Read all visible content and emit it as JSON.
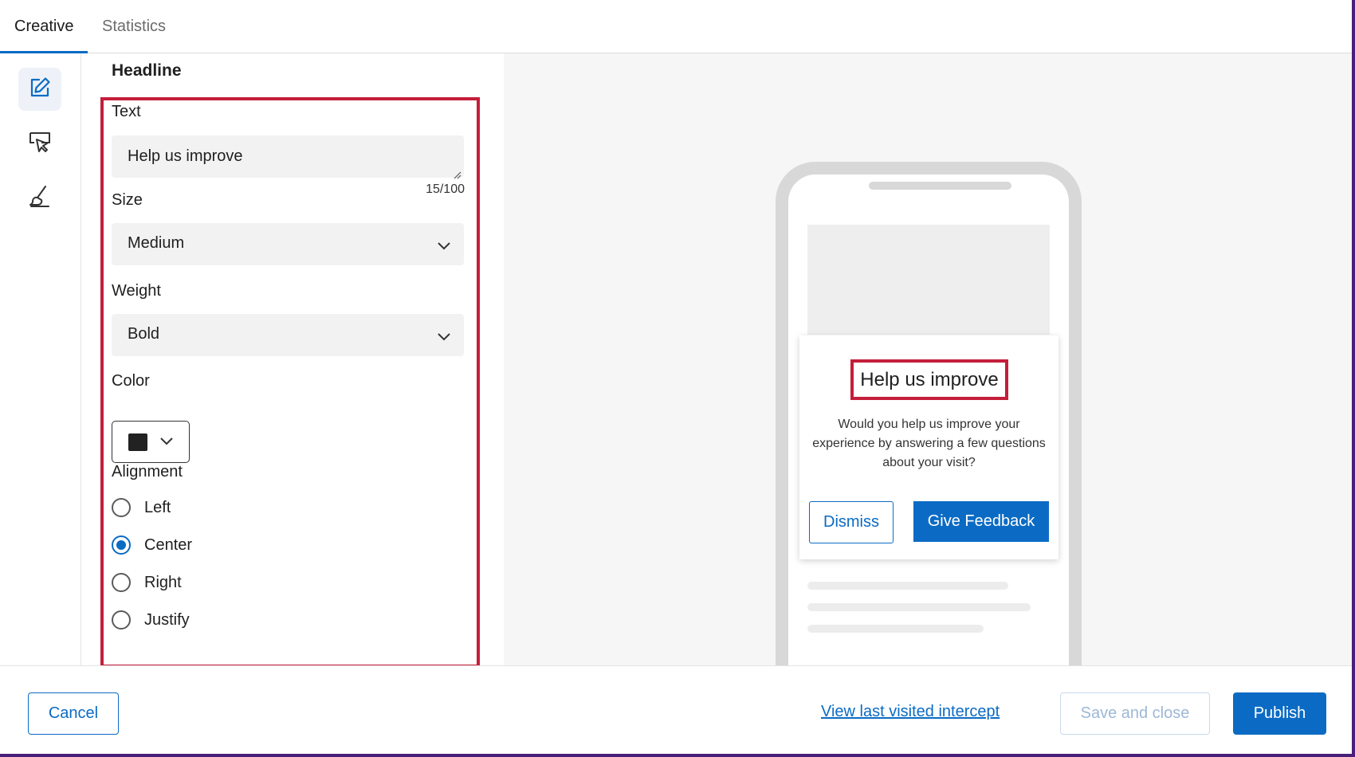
{
  "tabs": [
    {
      "label": "Creative",
      "active": true
    },
    {
      "label": "Statistics",
      "active": false
    }
  ],
  "rail": {
    "items": [
      {
        "icon": "edit-icon",
        "active": true
      },
      {
        "icon": "pointer-tooltip-icon",
        "active": false
      },
      {
        "icon": "paintbrush-icon",
        "active": false
      }
    ]
  },
  "editor": {
    "section_title": "Headline",
    "text": {
      "label": "Text",
      "value": "Help us improve",
      "counter": "15/100"
    },
    "size": {
      "label": "Size",
      "value": "Medium"
    },
    "weight": {
      "label": "Weight",
      "value": "Bold"
    },
    "color": {
      "label": "Color",
      "value": "#222222"
    },
    "alignment": {
      "label": "Alignment",
      "options": [
        "Left",
        "Center",
        "Right",
        "Justify"
      ],
      "selected": "Center"
    }
  },
  "preview": {
    "headline": "Help us improve",
    "body": "Would you help us improve your experience by answering a few questions about your visit?",
    "dismiss_label": "Dismiss",
    "feedback_label": "Give Feedback"
  },
  "footer": {
    "cancel_label": "Cancel",
    "intercept_link": "View last visited intercept",
    "save_label": "Save and close",
    "publish_label": "Publish"
  },
  "colors": {
    "accent": "#0b6bc4",
    "highlight": "#c41e3a",
    "field_bg": "#f2f2f2"
  }
}
